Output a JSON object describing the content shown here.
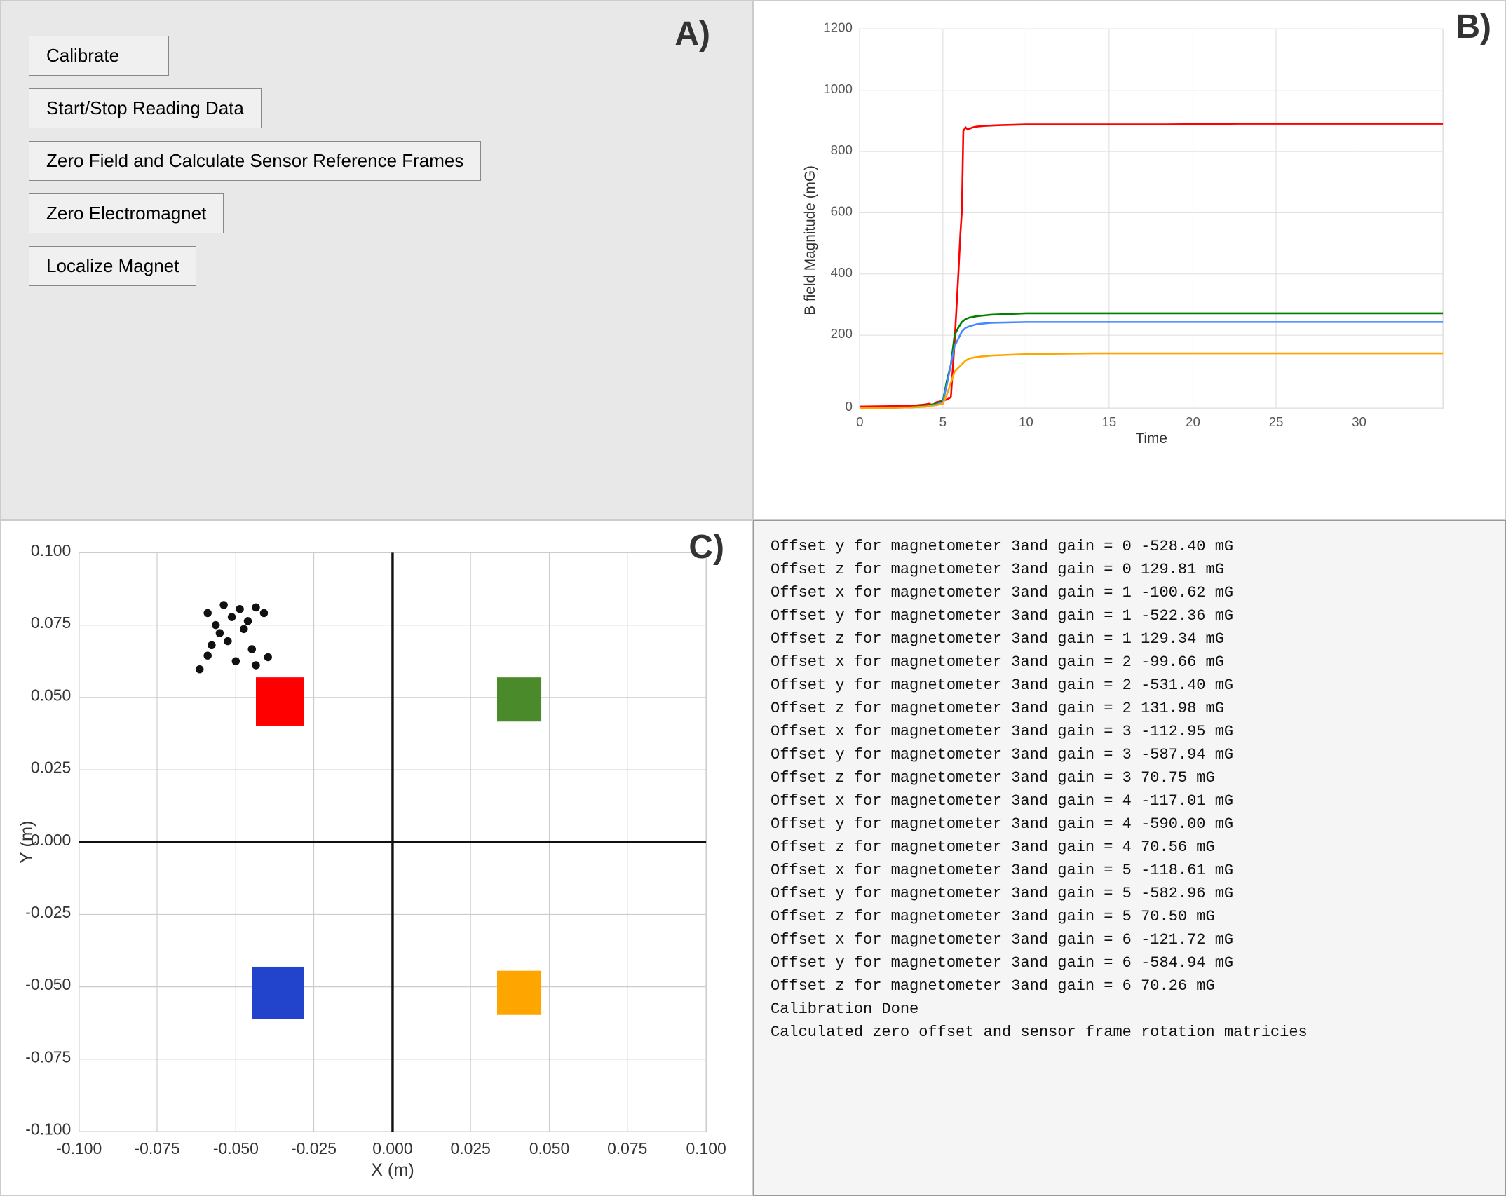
{
  "panelA": {
    "label": "A)",
    "buttons": [
      {
        "id": "calibrate",
        "label": "Calibrate"
      },
      {
        "id": "start-stop",
        "label": "Start/Stop Reading Data"
      },
      {
        "id": "zero-field",
        "label": "Zero Field and Calculate Sensor Reference Frames"
      },
      {
        "id": "zero-electromagnet",
        "label": "Zero Electromagnet"
      },
      {
        "id": "localize-magnet",
        "label": "Localize Magnet"
      }
    ]
  },
  "panelB": {
    "label": "B)",
    "yAxisLabel": "B field Magnitude (mG)",
    "xAxisLabel": "Time",
    "yTicks": [
      0,
      200,
      400,
      600,
      800,
      1000,
      1200
    ],
    "xTicks": [
      0,
      5,
      10,
      15,
      20,
      25,
      30
    ]
  },
  "panelC": {
    "label": "C)",
    "yAxisLabel": "Y (m)",
    "xAxisLabel": "X (m)",
    "yTicks": [
      0.1,
      0.075,
      0.05,
      0.025,
      0.0,
      -0.025,
      -0.05,
      -0.075,
      -0.1
    ],
    "xTicks": [
      -0.1,
      -0.075,
      -0.05,
      -0.025,
      0.0,
      0.025,
      0.05,
      0.075,
      0.1
    ]
  },
  "panelD": {
    "lines": [
      "Offset y for magnetometer 3and gain = 0 -528.40 mG",
      "Offset z for magnetometer 3and gain = 0 129.81 mG",
      "Offset x for magnetometer 3and gain = 1 -100.62 mG",
      "Offset y for magnetometer 3and gain = 1 -522.36 mG",
      "Offset z for magnetometer 3and gain = 1 129.34 mG",
      "Offset x for magnetometer 3and gain = 2 -99.66 mG",
      "Offset y for magnetometer 3and gain = 2 -531.40 mG",
      "Offset z for magnetometer 3and gain = 2 131.98 mG",
      "Offset x for magnetometer 3and gain = 3 -112.95 mG",
      "Offset y for magnetometer 3and gain = 3 -587.94 mG",
      "Offset z for magnetometer 3and gain = 3 70.75 mG",
      "Offset x for magnetometer 3and gain = 4 -117.01 mG",
      "Offset y for magnetometer 3and gain = 4 -590.00 mG",
      "Offset z for magnetometer 3and gain = 4 70.56 mG",
      "Offset x for magnetometer 3and gain = 5 -118.61 mG",
      "Offset y for magnetometer 3and gain = 5 -582.96 mG",
      "Offset z for magnetometer 3and gain = 5 70.50 mG",
      "Offset x for magnetometer 3and gain = 6 -121.72 mG",
      "Offset y for magnetometer 3and gain = 6 -584.94 mG",
      "Offset z for magnetometer 3and gain = 6 70.26 mG",
      "Calibration Done",
      "",
      "Calculated zero offset and sensor frame rotation matricies"
    ]
  }
}
